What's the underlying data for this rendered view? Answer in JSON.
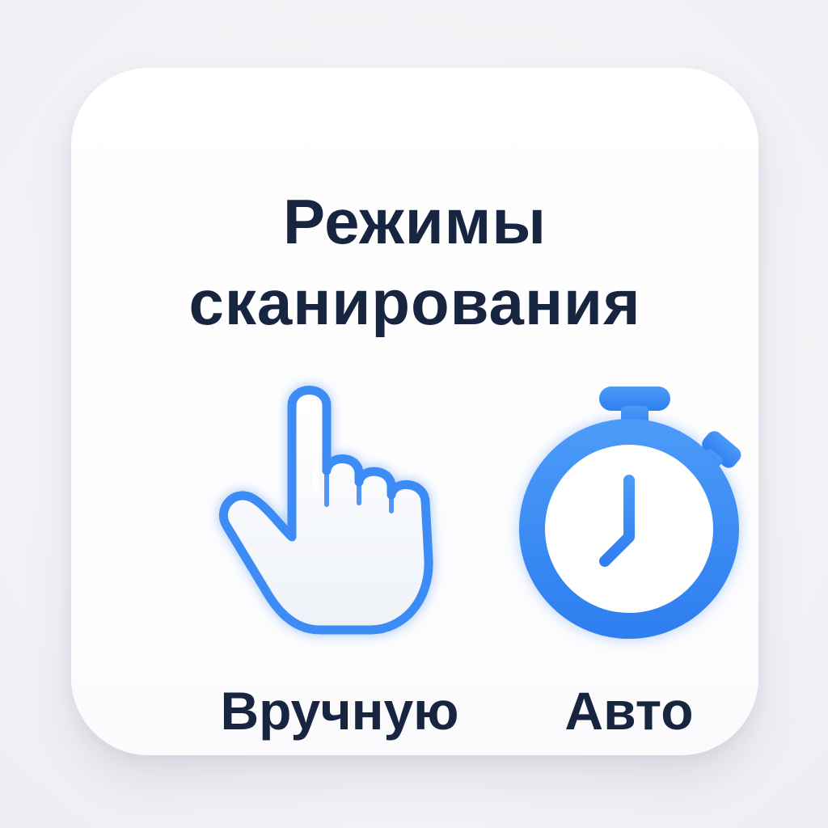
{
  "card": {
    "title_line1": "Режимы",
    "title_line2": "сканирования"
  },
  "modes": [
    {
      "label": "Вручную",
      "icon": "pointing-hand-icon"
    },
    {
      "label": "Авто",
      "icon": "stopwatch-icon"
    }
  ],
  "colors": {
    "accent": "#3d8cf5",
    "text": "#172540",
    "card": "#ffffff"
  }
}
